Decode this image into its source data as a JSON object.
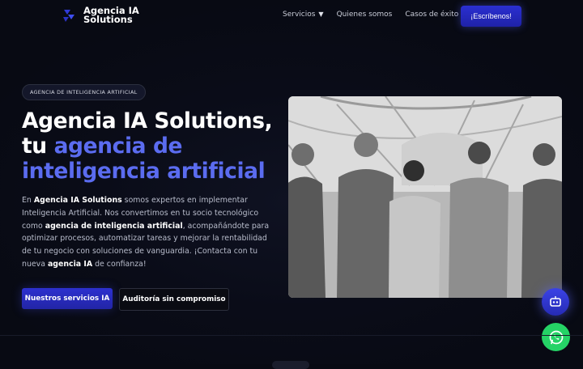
{
  "brand": {
    "line1": "Agencia IA",
    "line2": "Solutions",
    "accent": "#2f3ad8"
  },
  "nav": {
    "items": [
      {
        "label": "Servicios",
        "has_dropdown": true
      },
      {
        "label": "Quienes somos"
      },
      {
        "label": "Casos de éxito"
      }
    ],
    "cta": "¡Escríbenos!"
  },
  "hero": {
    "badge": "AGENCIA DE INTELIGENCIA ARTIFICIAL",
    "title_line1": "Agencia IA Solutions,",
    "title_line2_white": "tu ",
    "title_line2_blue": "agencia de",
    "title_line3_blue": "inteligencia artificial",
    "desc": {
      "p1": "En ",
      "b1": "Agencia IA Solutions",
      "p2": " somos expertos en implementar Inteligencia Artificial. Nos convertimos en tu socio tecnológico como ",
      "b2": "agencia de inteligencia artificial",
      "p3": ", acompañándote para optimizar procesos, automatizar tareas y mejorar la rentabilidad de tu negocio con soluciones de vanguardia. ¡Contacta con tu nueva ",
      "b3": "agencia IA",
      "p4": " de confianza!"
    },
    "primary_button": "Nuestros servicios IA",
    "secondary_button": "Auditoría sin compromiso"
  },
  "colors": {
    "accent_blue": "#5b6cf0",
    "button_blue": "#2a2fd0",
    "whatsapp_green": "#25d366"
  },
  "icons": {
    "chatbot": "robot-icon",
    "whatsapp": "whatsapp-icon",
    "dropdown": "chevron-down-icon"
  }
}
